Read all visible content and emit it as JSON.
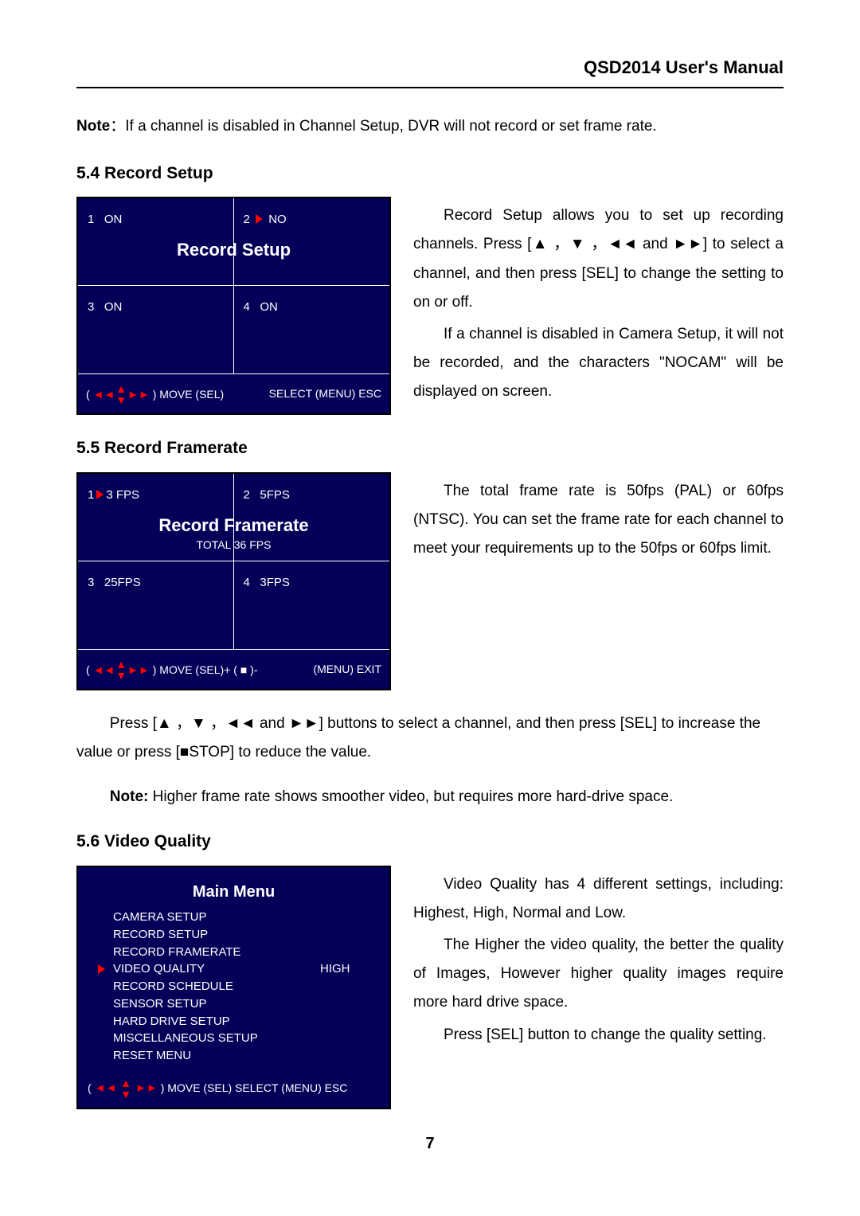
{
  "header": {
    "title": "QSD2014 User's Manual"
  },
  "note1": {
    "label": "Note",
    "sep": "：",
    "text": "If a channel is disabled in Channel Setup, DVR will not record or set frame rate."
  },
  "sec54": {
    "heading": "5.4 Record Setup",
    "panel": {
      "title": "Record Setup",
      "cells": {
        "c1_num": "1",
        "c1_val": "ON",
        "c2_num": "2",
        "c2_val": "NO",
        "c3_num": "3",
        "c3_val": "ON",
        "c4_num": "4",
        "c4_val": "ON"
      },
      "footer_left": ") MOVE (SEL)",
      "footer_right": "SELECT   (MENU) ESC",
      "footer_open": "("
    },
    "para1": "Record Setup allows you to set up recording channels. Press [▲ ，▼ ，◄◄ and ►►] to select a channel, and then press [SEL] to change the setting to on or off.",
    "para2": "If a channel is disabled in Camera Setup, it will not be recorded, and the characters \"NOCAM\" will be displayed on screen."
  },
  "sec55": {
    "heading": "5.5 Record Framerate",
    "panel": {
      "title": "Record Framerate",
      "total": "TOTAL  36 FPS",
      "cells": {
        "c1_num": "1",
        "c1_val": "3 FPS",
        "c2_num": "2",
        "c2_val": "5FPS",
        "c3_num": "3",
        "c3_val": "25FPS",
        "c4_num": "4",
        "c4_val": "3FPS"
      },
      "footer_open": "(",
      "footer_left": ") MOVE     (SEL)+ ( ■ )-",
      "footer_right": "(MENU) EXIT"
    },
    "para1": "The total frame rate is 50fps (PAL) or 60fps (NTSC). You can set the frame rate for each channel to meet your requirements up to the 50fps or 60fps limit.",
    "below1": "Press [▲ ，▼ ，◄◄ and ►►] buttons to select a channel, and then press [SEL] to increase the value or press [■STOP] to reduce the value.",
    "below2_label": "Note:",
    "below2_text": " Higher frame rate shows smoother video, but requires more hard-drive space."
  },
  "sec56": {
    "heading": "5.6 Video Quality",
    "menu": {
      "title": "Main Menu",
      "items": {
        "i0": "CAMERA SETUP",
        "i1": "RECORD SETUP",
        "i2": "RECORD FRAMERATE",
        "i3": "VIDEO QUALITY",
        "i3_val": "HIGH",
        "i4": "RECORD SCHEDULE",
        "i5": "SENSOR SETUP",
        "i6": "HARD DRIVE SETUP",
        "i7": "MISCELLANEOUS SETUP",
        "i8": "RESET MENU"
      },
      "footer_open": "(",
      "footer_text": " ) MOVE (SEL) SELECT (MENU) ESC"
    },
    "para1": "Video Quality has 4 different settings, including: Highest, High, Normal and Low.",
    "para2": "The Higher the video quality, the better the quality of Images, However higher quality images require more hard drive space.",
    "para3": "Press [SEL] button to change the quality setting."
  },
  "page_number": "7"
}
